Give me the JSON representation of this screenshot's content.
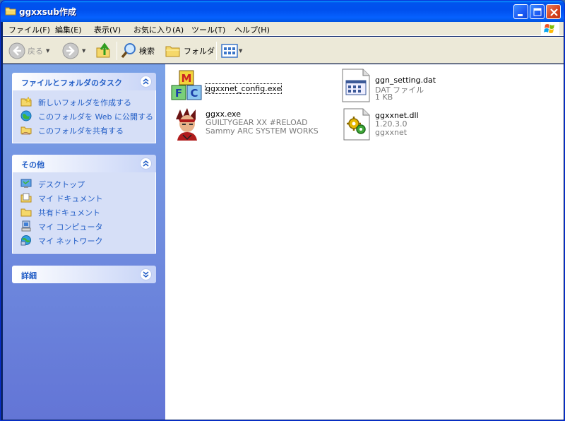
{
  "window": {
    "title": "ggxxsub作成",
    "icon": "folder-icon",
    "buttons": [
      "minimize",
      "maximize",
      "close"
    ]
  },
  "menu": {
    "items": [
      "ファイル(F)",
      "編集(E)",
      "表示(V)",
      "お気に入り(A)",
      "ツール(T)",
      "ヘルプ(H)"
    ]
  },
  "toolbar": {
    "back_label": "戻る",
    "search_label": "検索",
    "folders_label": "フォルダ"
  },
  "taskpane": {
    "file_tasks": {
      "title": "ファイルとフォルダのタスク",
      "items": [
        {
          "label": "新しいフォルダを作成する",
          "icon": "new-folder-icon"
        },
        {
          "label": "このフォルダを Web に公開する",
          "icon": "publish-web-icon"
        },
        {
          "label": "このフォルダを共有する",
          "icon": "share-folder-icon"
        }
      ]
    },
    "other_places": {
      "title": "その他",
      "items": [
        {
          "label": "デスクトップ",
          "icon": "desktop-icon"
        },
        {
          "label": "マイ ドキュメント",
          "icon": "my-documents-icon"
        },
        {
          "label": "共有ドキュメント",
          "icon": "shared-documents-icon"
        },
        {
          "label": "マイ コンピュータ",
          "icon": "my-computer-icon"
        },
        {
          "label": "マイ ネットワーク",
          "icon": "my-network-icon"
        }
      ]
    },
    "details": {
      "title": "詳細"
    }
  },
  "files": [
    {
      "name": "ggxxnet_config.exe",
      "line2": "",
      "line3": "",
      "icon": "mfc-app-icon",
      "focused": true
    },
    {
      "name": "ggn_setting.dat",
      "line2": "DAT ファイル",
      "line3": "1 KB",
      "icon": "dat-file-icon",
      "focused": false
    },
    {
      "name": "ggxx.exe",
      "line2": "GUILTYGEAR XX #RELOAD",
      "line3": "Sammy ARC SYSTEM WORKS",
      "icon": "game-character-icon",
      "focused": false
    },
    {
      "name": "ggxxnet.dll",
      "line2": "1.20.3.0",
      "line3": "ggxxnet",
      "icon": "dll-file-icon",
      "focused": false
    }
  ]
}
